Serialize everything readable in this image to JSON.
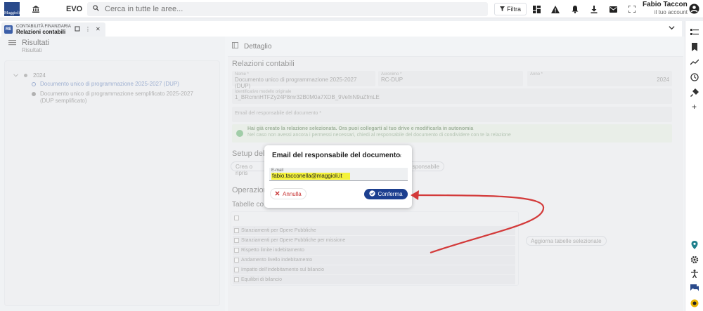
{
  "topbar": {
    "logo_text": "Maggioli",
    "app_name": "EVO",
    "search_placeholder": "Cerca in tutte le aree...",
    "filter_label": "Filtra",
    "user_name": "Fabio Tacconelli",
    "user_role": "il tuo account"
  },
  "tab": {
    "badge": "RE",
    "category": "CONTABILITÀ FINANZIARIA",
    "title": "Relazioni contabili"
  },
  "left_panel": {
    "title": "Risultati",
    "subtitle": "Risultati",
    "tree": {
      "year": "2024",
      "items": [
        {
          "label": "Documento unico di programmazione 2025-2027 (DUP)"
        },
        {
          "label": "Documento unico di programmazione semplificato 2025-2027 (DUP semplificato)"
        }
      ]
    }
  },
  "main_panel": {
    "header": "Dettaglio",
    "section_title": "Relazioni contabili",
    "fields": {
      "nome_label": "Nome *",
      "nome_value": "Documento unico di programmazione 2025-2027 (DUP)",
      "acronimo_label": "Acronimo *",
      "acronimo_value": "RC-DUP",
      "anno_label": "Anno *",
      "anno_value": "2024",
      "id_label": "Identificativo modello originale",
      "id_value": "1_BRcmnHTFZy24P8mr32B0M0a7XDB_9VefnN9uZfmLE",
      "email_placeholder": "Email del responsabile del documento *"
    },
    "alert": {
      "main": "Hai già creato la relazione selezionata. Ora puoi collegarti al tuo drive e modificarla in autonomia",
      "sub": "Nel caso non avessi ancora i permessi necessari, chiedi al responsabile del documento di condividere con te la relazione"
    },
    "setup_title": "Setup del",
    "setup_pill_left": "Crea o ripris",
    "setup_pill_right": "sponsabile",
    "operations_title": "Operazion",
    "tables_title": "Tabelle co",
    "table_rows": [
      {
        "label": "Stanziamenti per Opere Pubbliche"
      },
      {
        "label": "Stanziamenti per Opere Pubbliche per missione"
      },
      {
        "label": "Rispetto limite indebitamento"
      },
      {
        "label": "Andamento livello indebitamento"
      },
      {
        "label": "Impatto dell'indebitamento sul bilancio"
      },
      {
        "label": "Equilibri di bilancio"
      }
    ],
    "update_button": "Aggiorna tabelle selezionate"
  },
  "modal": {
    "title": "Email del responsabile del documento",
    "close_glyph": "×",
    "email_label": "E-mail",
    "email_value": "fabio.tacconella@maggioli.it",
    "cancel_label": "Annulla",
    "confirm_label": "Conferma"
  },
  "colors": {
    "primary": "#1c3f8f",
    "annotation_arrow": "#d33a3a",
    "highlight": "#f4f23a",
    "cancel": "#c63030"
  }
}
